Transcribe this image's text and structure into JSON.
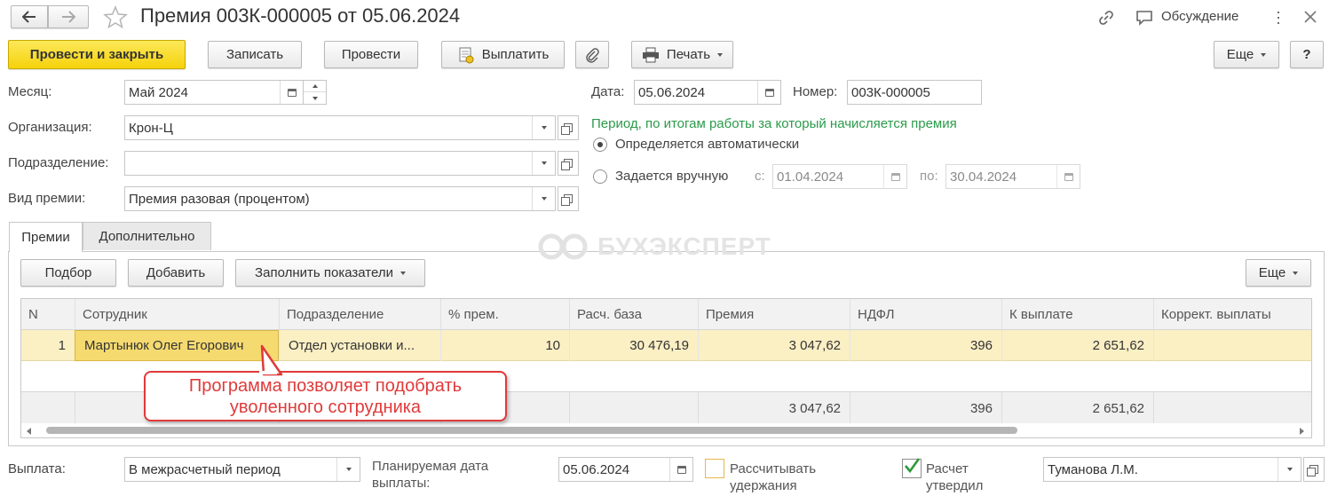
{
  "window": {
    "title": "Премия 003К-000005 от 05.06.2024",
    "discussion": "Обсуждение"
  },
  "toolbar": {
    "post_close": "Провести и закрыть",
    "save": "Записать",
    "post": "Провести",
    "pay": "Выплатить",
    "print": "Печать",
    "more": "Еще",
    "help": "?"
  },
  "fields": {
    "month_label": "Месяц:",
    "month_value": "Май 2024",
    "org_label": "Организация:",
    "org_value": "Крон-Ц",
    "dept_label": "Подразделение:",
    "dept_value": "",
    "bonus_type_label": "Вид премии:",
    "bonus_type_value": "Премия разовая (процентом)",
    "date_label": "Дата:",
    "date_value": "05.06.2024",
    "number_label": "Номер:",
    "number_value": "003К-000005"
  },
  "period": {
    "heading": "Период, по итогам работы за который начисляется премия",
    "auto": "Определяется автоматически",
    "manual": "Задается вручную",
    "from_label": "с:",
    "from_value": "01.04.2024",
    "to_label": "по:",
    "to_value": "30.04.2024",
    "selected": "auto"
  },
  "watermark": "БУХЭКСПЕРТ",
  "tabs": [
    {
      "label": "Премии",
      "active": true
    },
    {
      "label": "Дополнительно",
      "active": false
    }
  ],
  "table_toolbar": {
    "select": "Подбор",
    "add": "Добавить",
    "fill": "Заполнить показатели",
    "more": "Еще"
  },
  "table": {
    "columns": [
      "N",
      "Сотрудник",
      "Подразделение",
      "% прем.",
      "Расч. база",
      "Премия",
      "НДФЛ",
      "К выплате",
      "Коррект. выплаты"
    ],
    "rows": [
      {
        "n": "1",
        "employee": "Мартынюк Олег Егорович",
        "dept": "Отдел установки и...",
        "pct": "10",
        "base": "30 476,19",
        "bonus": "3 047,62",
        "ndfl": "396",
        "payout": "2 651,62",
        "correction": ""
      }
    ],
    "totals": {
      "bonus": "3 047,62",
      "ndfl": "396",
      "payout": "2 651,62"
    }
  },
  "callout": {
    "line1": "Программа позволяет подобрать",
    "line2": "уволенного сотрудника"
  },
  "footer": {
    "payment_label": "Выплата:",
    "payment_value": "В межрасчетный период",
    "planned_label_1": "Планируемая дата",
    "planned_label_2": "выплаты:",
    "planned_value": "05.06.2024",
    "calc_ded_1": "Рассчитывать",
    "calc_ded_2": "удержания",
    "approved_1": "Расчет",
    "approved_2": "утвердил",
    "approver": "Туманова Л.М."
  },
  "colors": {
    "accent_yellow": "#f5d20b",
    "green_heading": "#2a9a4a",
    "callout_red": "#e03a3a",
    "row_highlight": "#fbefc4"
  }
}
